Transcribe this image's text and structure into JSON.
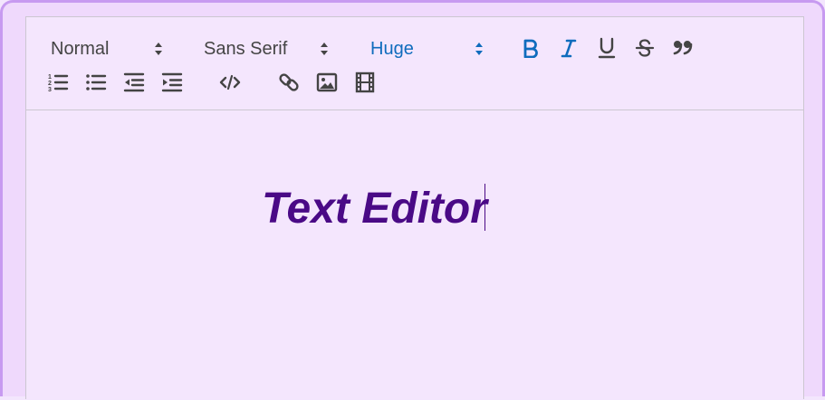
{
  "toolbar": {
    "header_picker": {
      "value": "Normal"
    },
    "font_picker": {
      "value": "Sans Serif"
    },
    "size_picker": {
      "value": "Huge"
    },
    "buttons": [
      {
        "icon": "bold-icon",
        "active": true
      },
      {
        "icon": "italic-icon",
        "active": true
      },
      {
        "icon": "underline-icon",
        "active": false
      },
      {
        "icon": "strikethrough-icon",
        "active": false
      },
      {
        "icon": "blockquote-icon",
        "active": false
      },
      {
        "icon": "ordered-list-icon",
        "active": false
      },
      {
        "icon": "bullet-list-icon",
        "active": false
      },
      {
        "icon": "outdent-icon",
        "active": false
      },
      {
        "icon": "indent-icon",
        "active": false
      },
      {
        "icon": "code-block-icon",
        "active": false
      },
      {
        "icon": "link-icon",
        "active": false
      },
      {
        "icon": "image-icon",
        "active": false
      },
      {
        "icon": "video-icon",
        "active": false
      }
    ]
  },
  "editor": {
    "content": "Text Editor"
  },
  "colors": {
    "active": "#0f6cbd",
    "icon": "#444444",
    "text": "#4a0a86",
    "background": "#f4e6fd",
    "frame": "#c79af0"
  }
}
